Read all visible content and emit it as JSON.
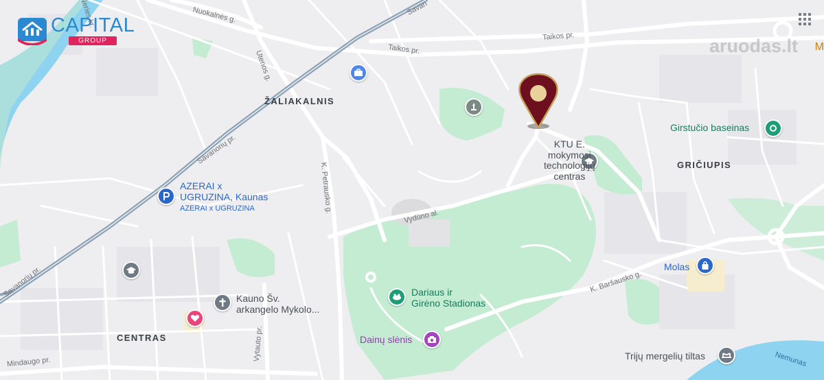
{
  "logo": {
    "name": "CAPITAL",
    "sub": "GROUP",
    "colors": {
      "blue": "#2a89d0",
      "pink": "#e0245e"
    }
  },
  "watermark": "aruodas.lt",
  "edge_letter": "M",
  "districts": {
    "zaliakalnis": "ŽALIAKALNIS",
    "griciupis": "GRIČIUPIS",
    "centras": "CENTRAS"
  },
  "streets": {
    "savanoriu_top": "Savan",
    "nuokalnes": "Nuokalnės g.",
    "neries": "Neries kr.",
    "taikos_left": "Taikos pr.",
    "taikos_right": "Taikos pr.",
    "utenos": "Utenos g.",
    "savanoriu_mid": "Savanorių pr.",
    "savanoriu_low": "Savanorių pr.",
    "k_petrausko": "K. Petrausko g.",
    "vyduno": "Vydūno al.",
    "k_barsausko": "K. Baršausko g.",
    "vytauto": "Vytauto pr.",
    "mindaugo": "Mindaugo pr.",
    "nemunas": "Nemunas"
  },
  "pois": {
    "ktu": "KTU E.\nmokymosi\ntechnologijų\ncentras",
    "girstucio": "Girstučio baseinas",
    "azerai": "AZERAI x\nUGRUZINA, Kaunas",
    "azerai_sub": "AZERAI x UGRUZINA",
    "molas": "Molas",
    "darius": "Dariaus ir\nGirėno Stadionas",
    "dainu": "Dainų slėnis",
    "kauno": "Kauno Šv.\narkangelo Mykolo...",
    "triju": "Trijų mergelių tiltas"
  },
  "colors": {
    "park": "#c4ecd3",
    "water": "#8ed4f0",
    "road": "#ffffff",
    "highway": "#8fa3b8",
    "background": "#eeeef0",
    "marker": "#6e0f1f",
    "marker_ring": "#c2a15a"
  },
  "icons": [
    "briefcase-icon",
    "monument-icon",
    "school-icon",
    "park-icon",
    "parking-icon",
    "stadium-icon",
    "camera-icon",
    "church-icon",
    "heart-icon",
    "shopping-bag-icon",
    "bridge-icon",
    "location-marker-icon",
    "grid-icon"
  ]
}
